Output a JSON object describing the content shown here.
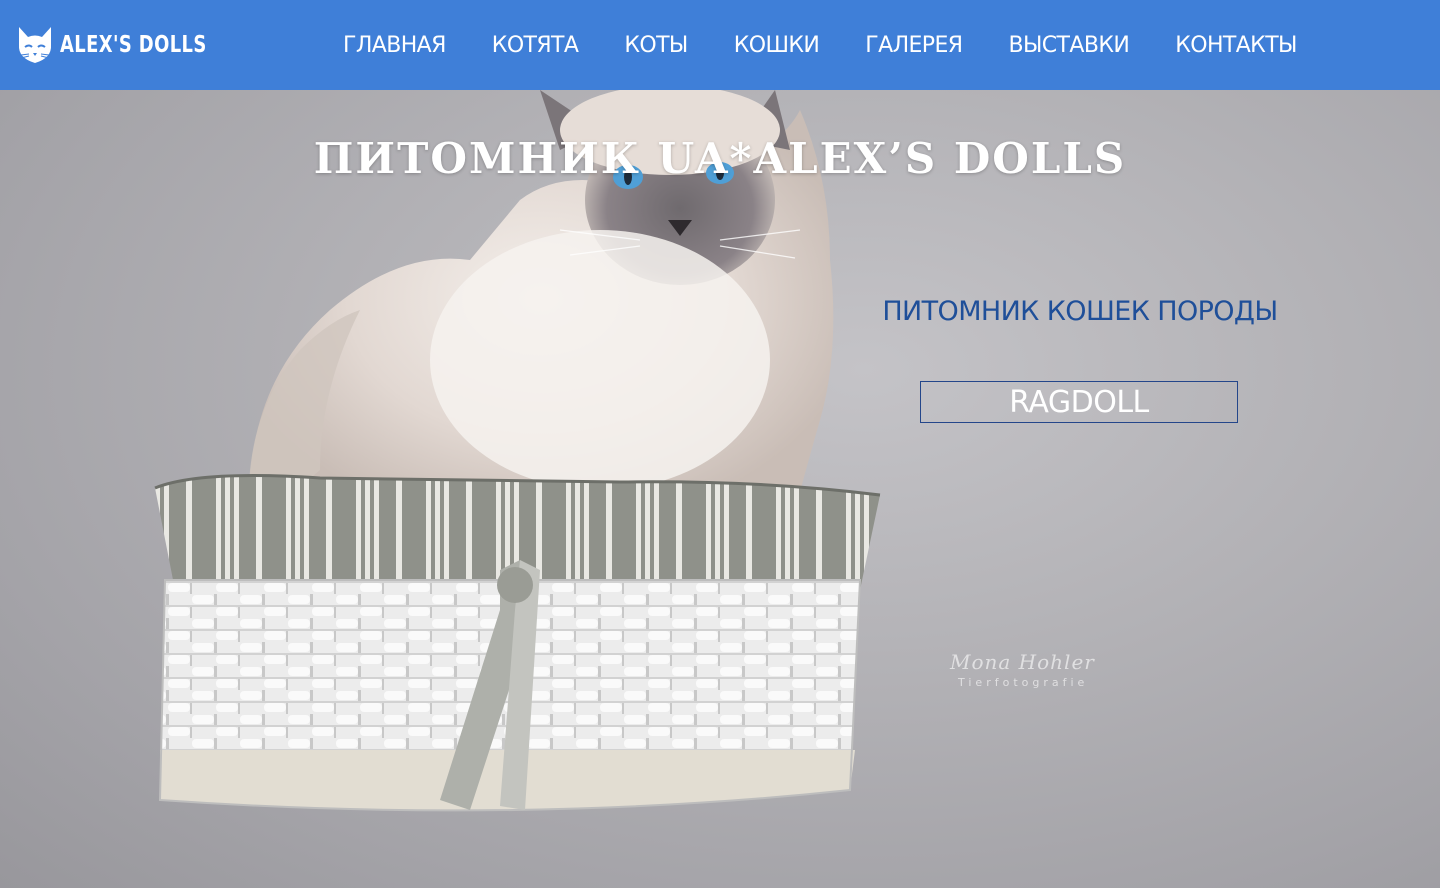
{
  "header": {
    "logo_text": "ALEX'S DOLLS",
    "logo_icon": "cat-head-icon",
    "background_color": "#3f7fd8",
    "nav": [
      {
        "label": "ГЛАВНАЯ"
      },
      {
        "label": "КОТЯТА"
      },
      {
        "label": "КОТЫ"
      },
      {
        "label": "КОШКИ"
      },
      {
        "label": "ГАЛЕРЕЯ"
      },
      {
        "label": "ВЫСТАВКИ"
      },
      {
        "label": "КОНТАКТЫ"
      }
    ]
  },
  "hero": {
    "title": "ПИТОМНИК UA*ALEX’S DOLLS",
    "subtitle": "ПИТОМНИК КОШЕК ПОРОДЫ",
    "breed_button": "RAGDOLL",
    "photo_signature": "Mona Hohler",
    "photo_signature_sub": "Tierfotografie",
    "subtitle_color": "#1f4f99"
  }
}
